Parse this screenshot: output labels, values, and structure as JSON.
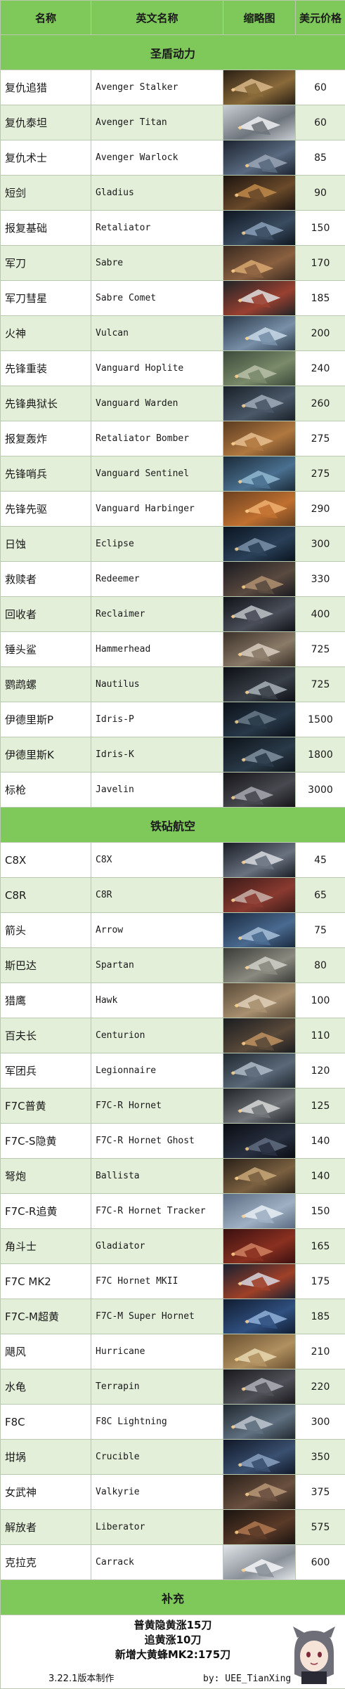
{
  "headers": {
    "cn": "名称",
    "en": "英文名称",
    "thumb": "缩略图",
    "price": "美元价格"
  },
  "sections": [
    {
      "title": "圣盾动力",
      "rows": [
        {
          "cn": "复仇追猎",
          "en": "Avenger Stalker",
          "price": "60",
          "palette": [
            "#2a1f14",
            "#8a6a3a",
            "#d9b98a"
          ]
        },
        {
          "cn": "复仇泰坦",
          "en": "Avenger Titan",
          "price": "60",
          "palette": [
            "#c8cdd3",
            "#6e747b",
            "#eef0f2"
          ]
        },
        {
          "cn": "复仇术士",
          "en": "Avenger Warlock",
          "price": "85",
          "palette": [
            "#1b2330",
            "#5a6a80",
            "#9aa6b6"
          ]
        },
        {
          "cn": "短剑",
          "en": "Gladius",
          "price": "90",
          "palette": [
            "#1c1410",
            "#6a4a2a",
            "#c08a4a"
          ]
        },
        {
          "cn": "报复基础",
          "en": "Retaliator",
          "price": "150",
          "palette": [
            "#0e1620",
            "#3a4c60",
            "#8aa0b8"
          ]
        },
        {
          "cn": "军刀",
          "en": "Sabre",
          "price": "170",
          "palette": [
            "#3a2a20",
            "#8a6040",
            "#d8a870"
          ]
        },
        {
          "cn": "军刀彗星",
          "en": "Sabre Comet",
          "price": "185",
          "palette": [
            "#202428",
            "#9a4030",
            "#e0e0e0"
          ]
        },
        {
          "cn": "火神",
          "en": "Vulcan",
          "price": "200",
          "palette": [
            "#2a3848",
            "#7890a8",
            "#c8d8e8"
          ]
        },
        {
          "cn": "先锋重装",
          "en": "Vanguard Hoplite",
          "price": "240",
          "palette": [
            "#3a4a3a",
            "#7a8a6a",
            "#b8c0a8"
          ]
        },
        {
          "cn": "先锋典狱长",
          "en": "Vanguard Warden",
          "price": "260",
          "palette": [
            "#182028",
            "#4a5868",
            "#a0acb8"
          ]
        },
        {
          "cn": "报复轰炸",
          "en": "Retaliator Bomber",
          "price": "275",
          "palette": [
            "#5a3a20",
            "#b07840",
            "#e8c090"
          ]
        },
        {
          "cn": "先锋哨兵",
          "en": "Vanguard Sentinel",
          "price": "275",
          "palette": [
            "#1a2a38",
            "#4a7090",
            "#90b8d0"
          ]
        },
        {
          "cn": "先锋先驱",
          "en": "Vanguard Harbinger",
          "price": "290",
          "palette": [
            "#6a4020",
            "#c07030",
            "#f0b070"
          ]
        },
        {
          "cn": "日蚀",
          "en": "Eclipse",
          "price": "300",
          "palette": [
            "#0a1420",
            "#2a4058",
            "#7a90a8"
          ]
        },
        {
          "cn": "救赎者",
          "en": "Redeemer",
          "price": "330",
          "palette": [
            "#1a1a20",
            "#5a4a40",
            "#b09070"
          ]
        },
        {
          "cn": "回收者",
          "en": "Reclaimer",
          "price": "400",
          "palette": [
            "#101218",
            "#4a4e58",
            "#c0c4c8"
          ]
        },
        {
          "cn": "锤头鲨",
          "en": "Hammerhead",
          "price": "725",
          "palette": [
            "#3a3028",
            "#8a7a68",
            "#d8ccc0"
          ]
        },
        {
          "cn": "鹦鹉螺",
          "en": "Nautilus",
          "price": "725",
          "palette": [
            "#0c0e14",
            "#3a4048",
            "#a8b0b8"
          ]
        },
        {
          "cn": "伊德里斯P",
          "en": "Idris-P",
          "price": "1500",
          "palette": [
            "#0a1018",
            "#283848",
            "#6a7a8a"
          ]
        },
        {
          "cn": "伊德里斯K",
          "en": "Idris-K",
          "price": "1800",
          "palette": [
            "#0c1218",
            "#2a3a48",
            "#8090a0"
          ]
        },
        {
          "cn": "标枪",
          "en": "Javelin",
          "price": "3000",
          "palette": [
            "#141418",
            "#484850",
            "#a8a8b0"
          ]
        }
      ]
    },
    {
      "title": "铁砧航空",
      "rows": [
        {
          "cn": "C8X",
          "en": "C8X",
          "price": "45",
          "palette": [
            "#181c24",
            "#6a7280",
            "#d8dce0"
          ]
        },
        {
          "cn": "C8R",
          "en": "C8R",
          "price": "65",
          "palette": [
            "#3a1a18",
            "#8a3a30",
            "#c8b0a8"
          ]
        },
        {
          "cn": "箭头",
          "en": "Arrow",
          "price": "75",
          "palette": [
            "#1a2a40",
            "#4a6a90",
            "#a8c0d8"
          ]
        },
        {
          "cn": "斯巴达",
          "en": "Spartan",
          "price": "80",
          "palette": [
            "#3a3a38",
            "#8a8a80",
            "#d0d0c8"
          ]
        },
        {
          "cn": "猎鹰",
          "en": "Hawk",
          "price": "100",
          "palette": [
            "#5a4a38",
            "#a89070",
            "#e0d0b8"
          ]
        },
        {
          "cn": "百夫长",
          "en": "Centurion",
          "price": "110",
          "palette": [
            "#1a1c20",
            "#5a4a3a",
            "#c09060"
          ]
        },
        {
          "cn": "军团兵",
          "en": "Legionnaire",
          "price": "120",
          "palette": [
            "#202830",
            "#5a6878",
            "#b0bcc8"
          ]
        },
        {
          "cn": "F7C普黄",
          "en": "F7C-R Hornet",
          "price": "125",
          "palette": [
            "#202428",
            "#707478",
            "#d8d8d8"
          ]
        },
        {
          "cn": "F7C-S隐黄",
          "en": "F7C-R Hornet Ghost",
          "price": "140",
          "palette": [
            "#0a0c12",
            "#283040",
            "#606c80"
          ]
        },
        {
          "cn": "弩炮",
          "en": "Ballista",
          "price": "140",
          "palette": [
            "#2a2018",
            "#7a6040",
            "#c8a878"
          ]
        },
        {
          "cn": "F7C-R追黄",
          "en": "F7C-R Hornet Tracker",
          "price": "150",
          "palette": [
            "#5a6a80",
            "#a0b0c4",
            "#e8eef4"
          ]
        },
        {
          "cn": "角斗士",
          "en": "Gladiator",
          "price": "165",
          "palette": [
            "#3a1010",
            "#8a3020",
            "#d08060"
          ]
        },
        {
          "cn": "F7C MK2",
          "en": "F7C Hornet MKII",
          "price": "175",
          "palette": [
            "#182030",
            "#a04028",
            "#d8d8e0"
          ]
        },
        {
          "cn": "F7C-M超黄",
          "en": "F7C-M Super Hornet",
          "price": "185",
          "palette": [
            "#101c30",
            "#305080",
            "#90b0d8"
          ]
        },
        {
          "cn": "飓风",
          "en": "Hurricane",
          "price": "210",
          "palette": [
            "#6a5030",
            "#b09060",
            "#e8d8b0"
          ]
        },
        {
          "cn": "水龟",
          "en": "Terrapin",
          "price": "220",
          "palette": [
            "#18181c",
            "#505058",
            "#b0b0b8"
          ]
        },
        {
          "cn": "F8C",
          "en": "F8C Lightning",
          "price": "300",
          "palette": [
            "#202830",
            "#607080",
            "#c0c8d0"
          ]
        },
        {
          "cn": "坩埚",
          "en": "Crucible",
          "price": "350",
          "palette": [
            "#101828",
            "#3a5070",
            "#8aa0c0"
          ]
        },
        {
          "cn": "女武神",
          "en": "Valkyrie",
          "price": "375",
          "palette": [
            "#2a2018",
            "#6a5040",
            "#b89878"
          ]
        },
        {
          "cn": "解放者",
          "en": "Liberator",
          "price": "575",
          "palette": [
            "#1a1410",
            "#5a3a28",
            "#b07850"
          ]
        },
        {
          "cn": "克拉克",
          "en": "Carrack",
          "price": "600",
          "palette": [
            "#e0e4e8",
            "#8a9098",
            "#f4f6f8"
          ]
        }
      ]
    }
  ],
  "supplement": {
    "title": "补充",
    "notes": [
      "普黄隐黄涨15刀",
      "追黄涨10刀",
      "新增大黄蜂MK2:175刀"
    ],
    "version": "3.22.1版本制作",
    "author": "by: UEE_TianXing"
  },
  "colors": {
    "accent": "#7fc85a",
    "row_alt": "#e3efd9",
    "border": "#b8c9b0"
  }
}
